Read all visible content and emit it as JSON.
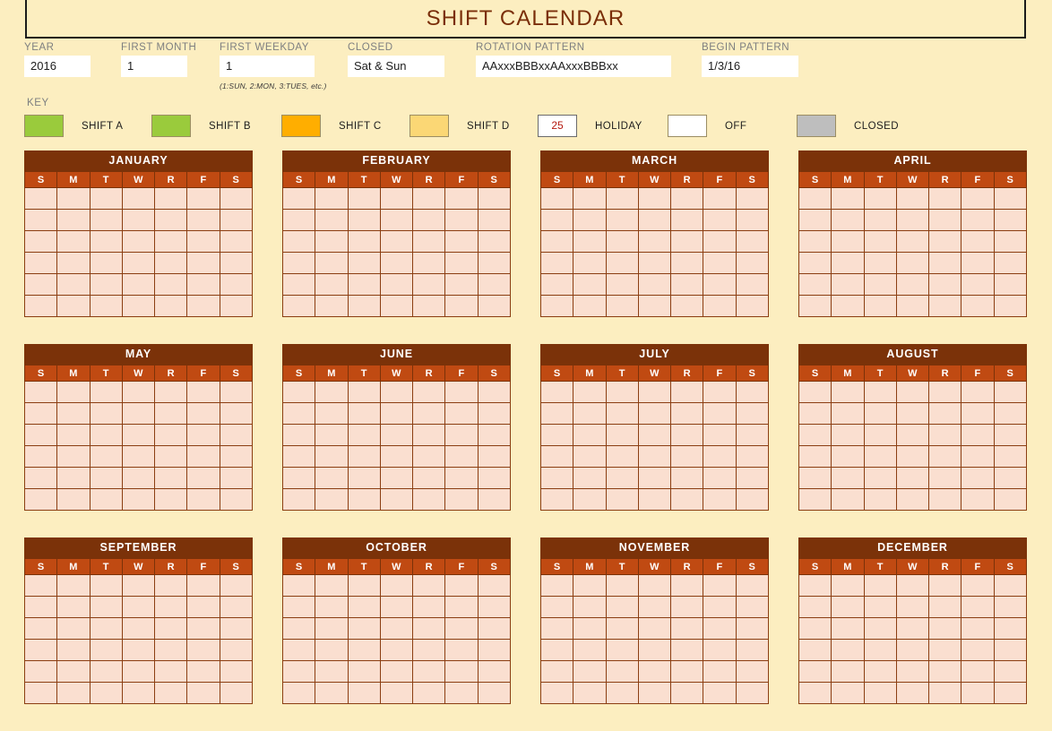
{
  "header": {
    "title": "SHIFT CALENDAR"
  },
  "settings": {
    "year": {
      "label": "YEAR",
      "value": "2016"
    },
    "first_month": {
      "label": "FIRST MONTH",
      "value": "1"
    },
    "first_weekday": {
      "label": "FIRST WEEKDAY",
      "value": "1",
      "note": "(1:SUN, 2:MON, 3:TUES, etc.)"
    },
    "closed": {
      "label": "CLOSED",
      "value": "Sat & Sun"
    },
    "rotation_pattern": {
      "label": "ROTATION PATTERN",
      "value": "AAxxxBBBxxAAxxxBBBxx"
    },
    "begin_pattern": {
      "label": "BEGIN PATTERN",
      "value": "1/3/16"
    }
  },
  "key": {
    "label": "KEY",
    "items": [
      {
        "label": "SHIFT A",
        "color": "#9ACB3C",
        "text": ""
      },
      {
        "label": "SHIFT B",
        "color": "#9ACB3C",
        "text": ""
      },
      {
        "label": "SHIFT C",
        "color": "#FFAE00",
        "text": ""
      },
      {
        "label": "SHIFT D",
        "color": "#FBD775",
        "text": ""
      },
      {
        "label": "HOLIDAY",
        "color": "#FFFFFF",
        "text": "25"
      },
      {
        "label": "OFF",
        "color": "#FFFFFF",
        "text": ""
      },
      {
        "label": "CLOSED",
        "color": "#BEBEBE",
        "text": ""
      }
    ]
  },
  "calendar": {
    "weekday_headers": [
      "S",
      "M",
      "T",
      "W",
      "R",
      "F",
      "S"
    ],
    "week_rows": 6,
    "months": [
      "JANUARY",
      "FEBRUARY",
      "MARCH",
      "APRIL",
      "MAY",
      "JUNE",
      "JULY",
      "AUGUST",
      "SEPTEMBER",
      "OCTOBER",
      "NOVEMBER",
      "DECEMBER"
    ]
  },
  "colors": {
    "page_background": "#FCEEC0",
    "title_text": "#7A2E09",
    "month_title_bar": "#7B3209",
    "weekday_header": "#C04A12",
    "day_cell": "#FADFD0",
    "cell_border": "#8B3E12",
    "holiday_text": "#B51A10"
  }
}
